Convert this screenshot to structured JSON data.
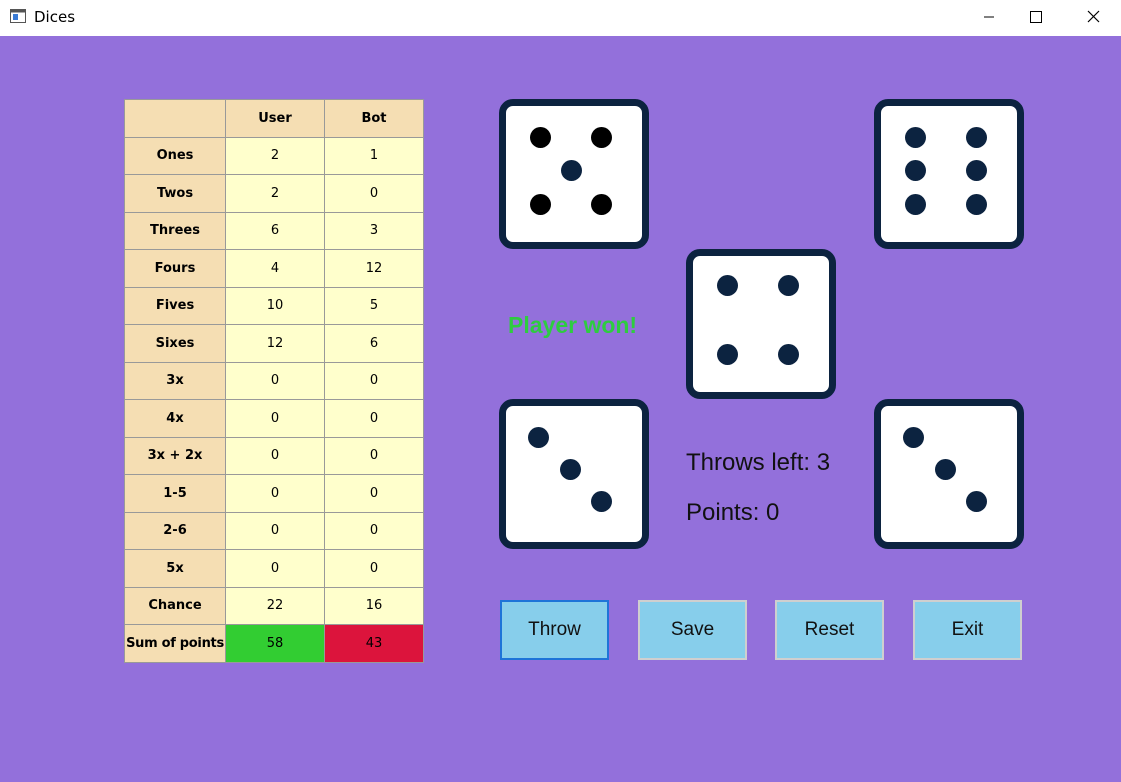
{
  "window": {
    "title": "Dices"
  },
  "status": {
    "text": "Player won!",
    "color": "#2ECC40"
  },
  "info": {
    "throws_left": "Throws left: 3",
    "points": "Points: 0"
  },
  "buttons": {
    "throw": "Throw",
    "save": "Save",
    "reset": "Reset",
    "exit": "Exit"
  },
  "table": {
    "headers": {
      "corner": "",
      "user": "User",
      "bot": "Bot"
    },
    "rows": [
      {
        "label": "Ones",
        "user": "2",
        "bot": "1"
      },
      {
        "label": "Twos",
        "user": "2",
        "bot": "0"
      },
      {
        "label": "Threes",
        "user": "6",
        "bot": "3"
      },
      {
        "label": "Fours",
        "user": "4",
        "bot": "12"
      },
      {
        "label": "Fives",
        "user": "10",
        "bot": "5"
      },
      {
        "label": "Sixes",
        "user": "12",
        "bot": "6"
      },
      {
        "label": "3x",
        "user": "0",
        "bot": "0"
      },
      {
        "label": "4x",
        "user": "0",
        "bot": "0"
      },
      {
        "label": "3x + 2x",
        "user": "0",
        "bot": "0"
      },
      {
        "label": "1-5",
        "user": "0",
        "bot": "0"
      },
      {
        "label": "2-6",
        "user": "0",
        "bot": "0"
      },
      {
        "label": "5x",
        "user": "0",
        "bot": "0"
      },
      {
        "label": "Chance",
        "user": "22",
        "bot": "16"
      }
    ],
    "sum": {
      "label": "Sum of points",
      "user": "58",
      "bot": "43",
      "user_color": "#32CD32",
      "bot_color": "#DC143C"
    }
  },
  "dice": [
    {
      "value": 5
    },
    {
      "value": 6
    },
    {
      "value": 4
    },
    {
      "value": 3
    },
    {
      "value": 3
    }
  ],
  "colors": {
    "background": "#9370DB",
    "die_border": "#0C2340",
    "pip": "#0C2340",
    "button": "#87CEEB"
  }
}
